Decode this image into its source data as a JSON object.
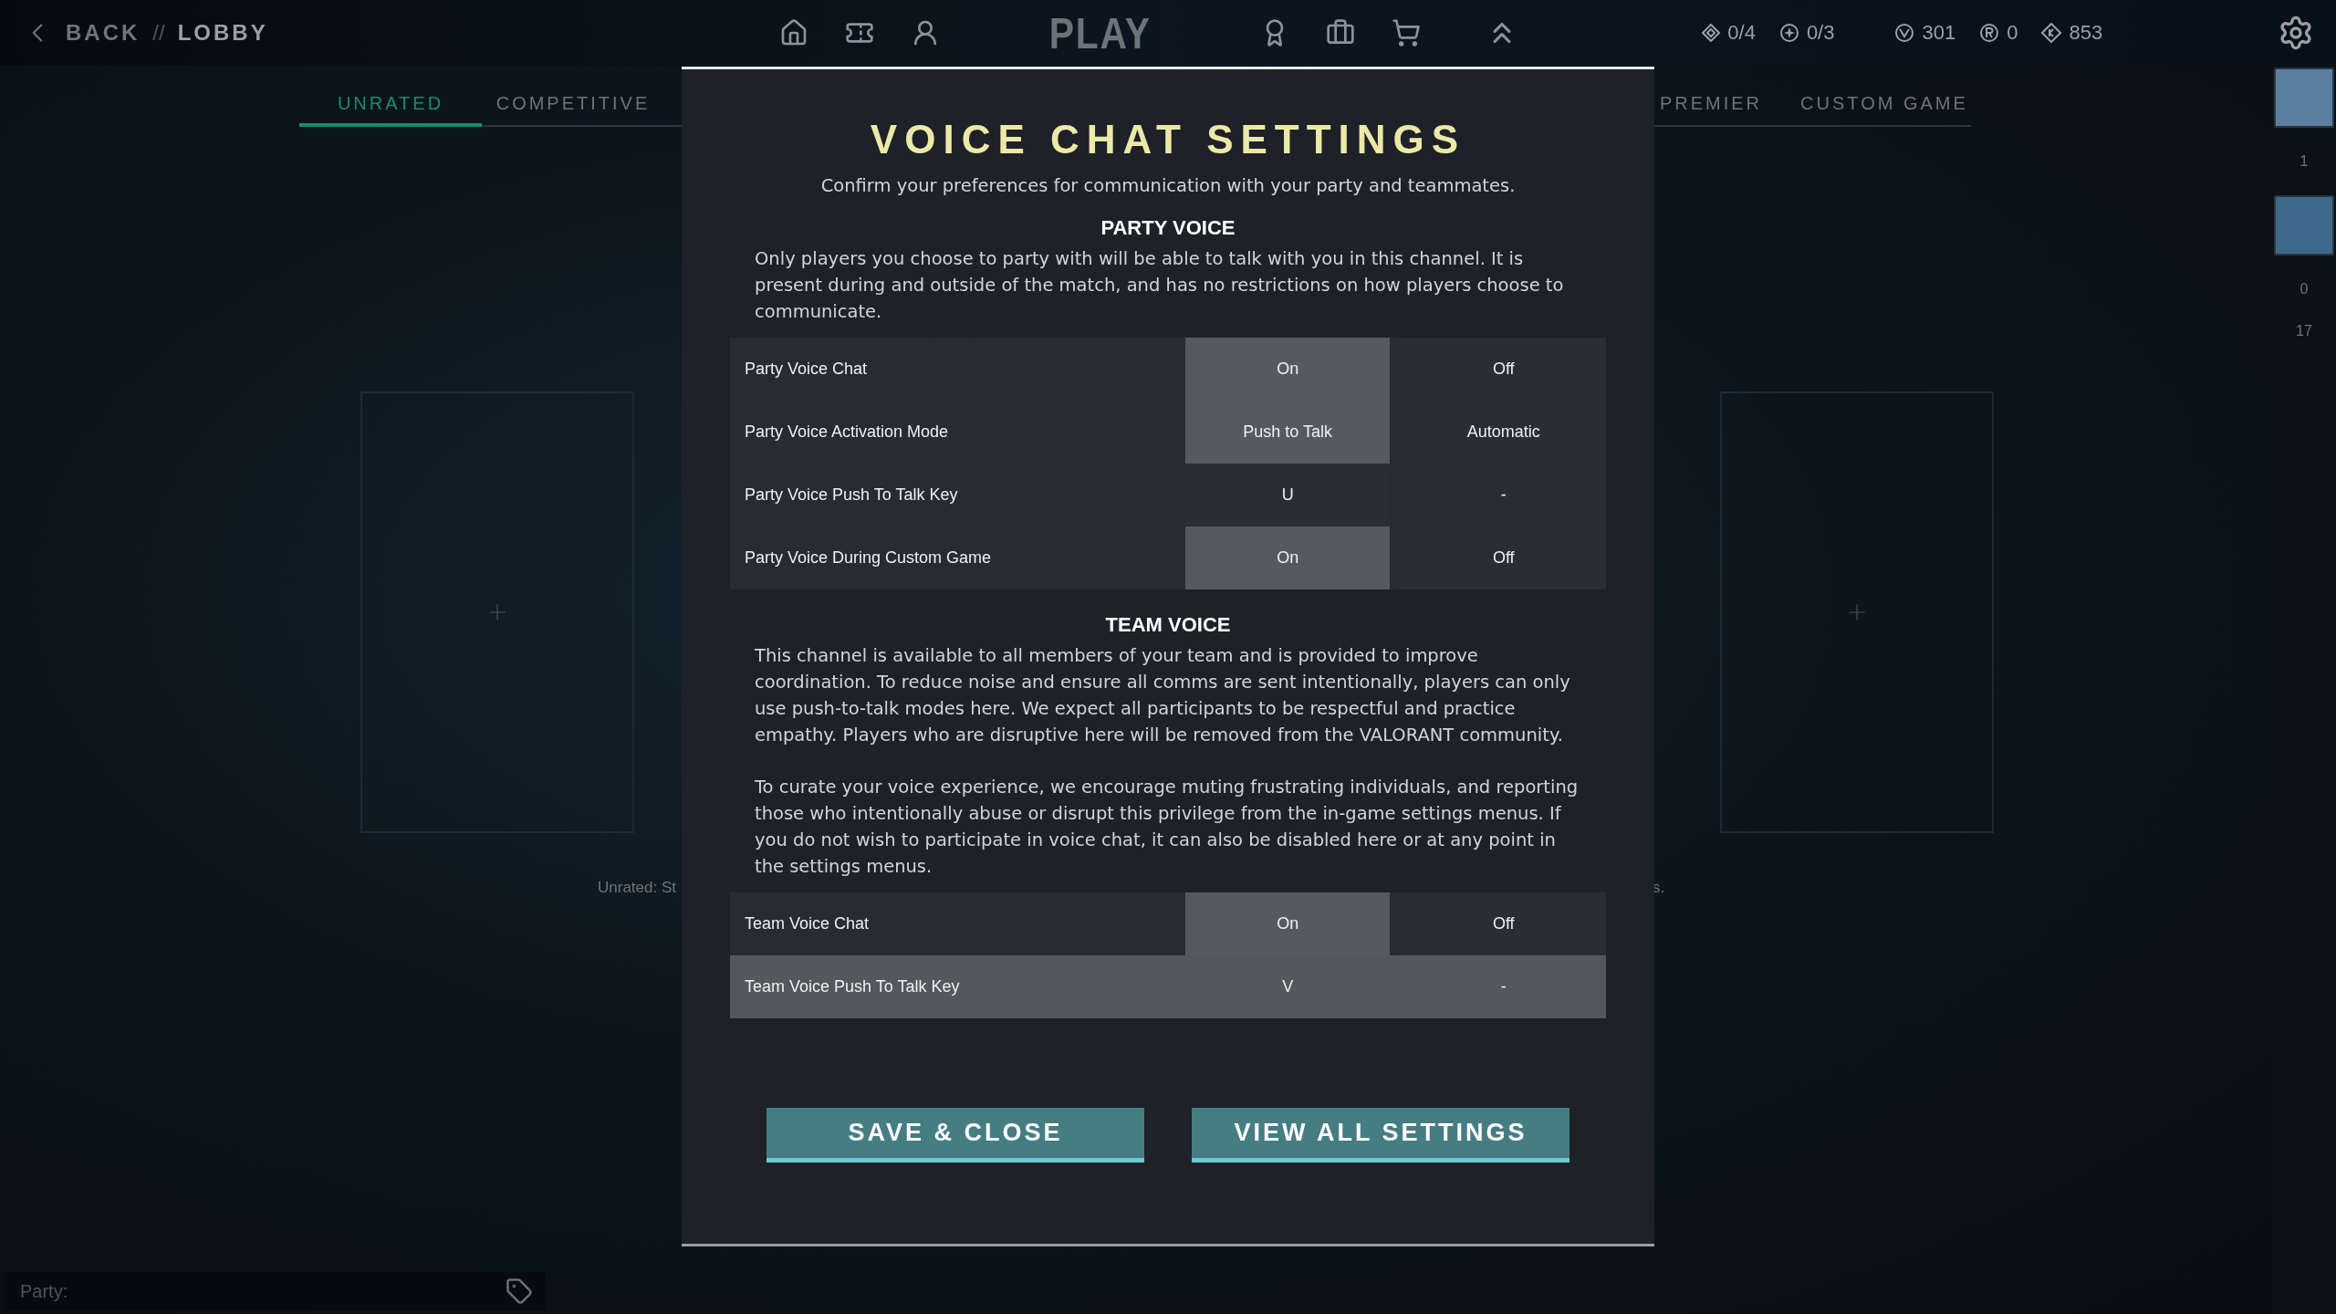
{
  "header": {
    "back": "BACK",
    "separator": "//",
    "location": "LOBBY",
    "title": "PLAY",
    "currencies": [
      {
        "kind": "diamond",
        "value": "0/4"
      },
      {
        "kind": "star",
        "value": "0/3"
      },
      {
        "kind": "v-coin",
        "value": "301"
      },
      {
        "kind": "r-coin",
        "value": "0"
      },
      {
        "kind": "k-diamond",
        "value": "853"
      }
    ]
  },
  "mode_tabs": [
    {
      "label": "UNRATED",
      "selected": true
    },
    {
      "label": "COMPETITIVE",
      "selected": false
    },
    {
      "label": "PREMIER",
      "selected": false
    },
    {
      "label": "CUSTOM GAME",
      "selected": false
    }
  ],
  "lobby": {
    "mode_description_start": "Unrated: St",
    "mode_description_end": "s."
  },
  "friends_sidebar": {
    "counts": [
      "1",
      "0",
      "17"
    ]
  },
  "party_bar": {
    "placeholder": "Party:"
  },
  "dialog": {
    "title": "VOICE CHAT SETTINGS",
    "subtitle": "Confirm your preferences for communication with your party and teammates.",
    "sections": [
      {
        "heading": "PARTY VOICE",
        "paragraphs": [
          "Only players you choose to party with will be able to talk with you in this channel. It is present during and outside of the match, and has no restrictions on how players choose to communicate."
        ],
        "rows": [
          {
            "label": "Party Voice Chat",
            "highlighted": false,
            "options": [
              {
                "label": "On",
                "selected": true
              },
              {
                "label": "Off",
                "selected": false
              }
            ]
          },
          {
            "label": "Party Voice Activation Mode",
            "highlighted": false,
            "options": [
              {
                "label": "Push to Talk",
                "selected": true
              },
              {
                "label": "Automatic",
                "selected": false
              }
            ]
          },
          {
            "label": "Party Voice Push To Talk Key",
            "highlighted": false,
            "options": [
              {
                "label": "U",
                "selected": false
              },
              {
                "label": "-",
                "selected": false
              }
            ]
          },
          {
            "label": "Party Voice During Custom Game",
            "highlighted": false,
            "options": [
              {
                "label": "On",
                "selected": true
              },
              {
                "label": "Off",
                "selected": false
              }
            ]
          }
        ]
      },
      {
        "heading": "TEAM VOICE",
        "paragraphs": [
          "This channel is available to all members of your team and is provided to improve coordination. To reduce noise and ensure all comms are sent intentionally, players can only use push-to-talk modes here. We expect all participants to be respectful and practice empathy.  Players who are disruptive here will be removed from the VALORANT community.",
          "To curate your voice experience, we encourage muting frustrating individuals, and reporting those who intentionally abuse or disrupt this privilege from the in-game settings menus. If you do not wish to participate in voice chat, it can also be disabled here or at any point in the settings menus."
        ],
        "rows": [
          {
            "label": "Team Voice Chat",
            "highlighted": false,
            "options": [
              {
                "label": "On",
                "selected": true
              },
              {
                "label": "Off",
                "selected": false
              }
            ]
          },
          {
            "label": "Team Voice Push To Talk Key",
            "highlighted": true,
            "options": [
              {
                "label": "V",
                "selected": false
              },
              {
                "label": "-",
                "selected": false
              }
            ]
          }
        ]
      }
    ],
    "buttons": [
      "SAVE & CLOSE",
      "VIEW ALL SETTINGS"
    ]
  }
}
